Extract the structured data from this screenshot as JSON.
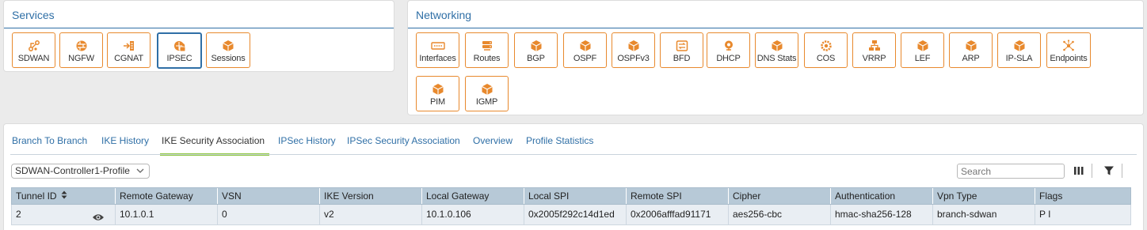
{
  "services": {
    "title": "Services",
    "tiles": [
      {
        "label": "SDWAN",
        "icon": "sdwan-icon"
      },
      {
        "label": "NGFW",
        "icon": "firewall-icon"
      },
      {
        "label": "CGNAT",
        "icon": "cgnat-icon"
      },
      {
        "label": "IPSEC",
        "icon": "ipsec-lock-icon"
      },
      {
        "label": "Sessions",
        "icon": "cube-icon"
      }
    ],
    "active": "IPSEC"
  },
  "networking": {
    "title": "Networking",
    "tiles": [
      {
        "label": "Interfaces",
        "icon": "interfaces-icon"
      },
      {
        "label": "Routes",
        "icon": "router-icon"
      },
      {
        "label": "BGP",
        "icon": "cube-icon"
      },
      {
        "label": "OSPF",
        "icon": "cube-icon"
      },
      {
        "label": "OSPFv3",
        "icon": "cube-icon"
      },
      {
        "label": "BFD",
        "icon": "bfd-icon"
      },
      {
        "label": "DHCP",
        "icon": "dhcp-icon"
      },
      {
        "label": "DNS Stats",
        "icon": "cube-icon"
      },
      {
        "label": "COS",
        "icon": "cos-gear-icon"
      },
      {
        "label": "VRRP",
        "icon": "vrrp-icon"
      },
      {
        "label": "LEF",
        "icon": "cube-icon"
      },
      {
        "label": "ARP",
        "icon": "cube-icon"
      },
      {
        "label": "IP-SLA",
        "icon": "cube-icon"
      },
      {
        "label": "Endpoints",
        "icon": "endpoints-icon"
      },
      {
        "label": "PIM",
        "icon": "cube-icon"
      },
      {
        "label": "IGMP",
        "icon": "cube-icon"
      }
    ]
  },
  "tabs": {
    "items": [
      "Branch To Branch",
      "IKE History",
      "IKE Security Association",
      "IPSec History",
      "IPSec Security Association",
      "Overview",
      "Profile Statistics"
    ],
    "active": "IKE Security Association"
  },
  "profile_select": {
    "value": "SDWAN-Controller1-Profile"
  },
  "search": {
    "placeholder": "Search"
  },
  "table": {
    "columns": [
      "Tunnel ID",
      "Remote Gateway",
      "VSN",
      "IKE Version",
      "Local Gateway",
      "Local SPI",
      "Remote SPI",
      "Cipher",
      "Authentication",
      "Vpn Type",
      "Flags"
    ],
    "rows": [
      [
        "2",
        "10.1.0.1",
        "0",
        "v2",
        "10.1.0.106",
        "0x2005f292c14d1ed",
        "0x2006afffad91171",
        "aes256-cbc",
        "hmac-sha256-128",
        "branch-sdwan",
        "P I"
      ]
    ]
  },
  "colors": {
    "accent_orange": "#e8892d",
    "brand_blue": "#2f6fa6",
    "tab_active_underline": "#8dc63f",
    "header_bg": "#b7c9d7"
  }
}
